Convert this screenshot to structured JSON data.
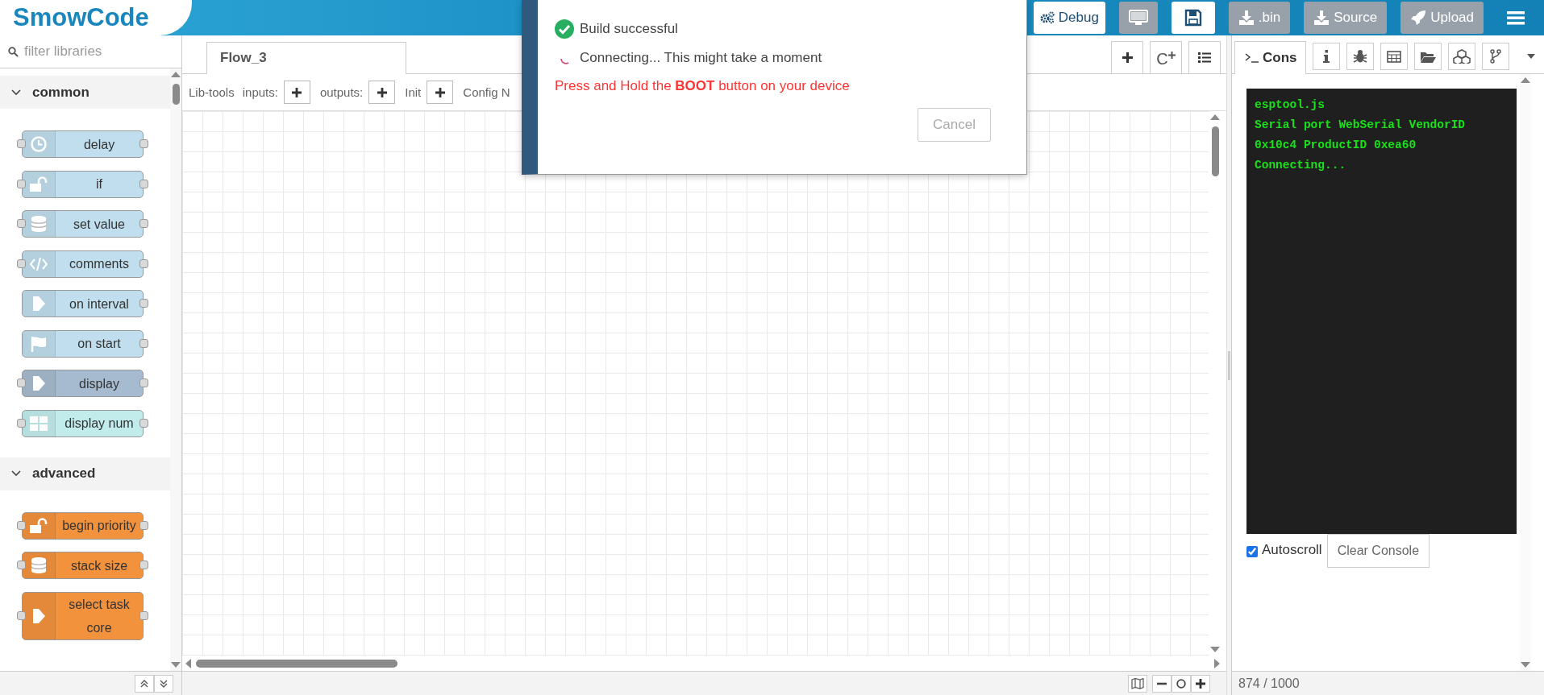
{
  "header": {
    "logo": "SmowCode",
    "buttons": [
      {
        "kind": "debug",
        "label": "Debug",
        "disabled": false
      },
      {
        "kind": "monitor",
        "disabled": true
      },
      {
        "kind": "save",
        "disabled": false
      },
      {
        "kind": "download",
        "label": ".bin",
        "disabled": true
      },
      {
        "kind": "download",
        "label": "Source",
        "disabled": true
      },
      {
        "kind": "upload",
        "label": "Upload",
        "disabled": true
      }
    ]
  },
  "palette": {
    "filter": {
      "placeholder": "filter libraries"
    },
    "categories": [
      {
        "name": "common",
        "expanded": true,
        "nodes": [
          {
            "label": "delay",
            "color": "#c0deed",
            "input": true,
            "output": true
          },
          {
            "label": "if",
            "color": "#c0deed",
            "input": true,
            "output": true
          },
          {
            "label": "set value",
            "color": "#c0deed",
            "input": true,
            "output": true
          },
          {
            "label": "comments",
            "color": "#c0deed",
            "input": true,
            "output": true
          },
          {
            "label": "on interval",
            "color": "#c0deed",
            "input": false,
            "output": true
          },
          {
            "label": "on start",
            "color": "#c0deed",
            "input": false,
            "output": true
          },
          {
            "label": "display",
            "color": "#a6bbcf",
            "input": true,
            "output": true
          },
          {
            "label": "display num",
            "color": "#c2ecec",
            "input": true,
            "output": true
          }
        ]
      },
      {
        "name": "advanced",
        "expanded": true,
        "nodes": [
          {
            "label": "begin priority",
            "color": "#f2923d",
            "input": true,
            "output": true
          },
          {
            "label": "stack size",
            "color": "#f2923d",
            "input": true,
            "output": true
          },
          {
            "label": "select task core",
            "color": "#f2923d",
            "input": true,
            "output": true
          }
        ]
      }
    ]
  },
  "workspace": {
    "tabs": [
      {
        "label": "Flow_3",
        "selected": true
      }
    ],
    "tab_actions": [
      {
        "kind": "add"
      },
      {
        "kind": "subflow",
        "label": "C"
      },
      {
        "kind": "list"
      }
    ],
    "toolbar": {
      "label": "Lib-tools",
      "fields": [
        {
          "label": "inputs:"
        },
        {
          "label": "outputs:"
        },
        {
          "label": "Init"
        }
      ],
      "cut_label": "Config N"
    }
  },
  "dialog": {
    "messages": [
      {
        "kind": "success",
        "text": "Build successful"
      },
      {
        "kind": "pending",
        "text": "Connecting... This might take a moment"
      }
    ],
    "warning": "Press and Hold the **BOOT** button on your device",
    "cancel": {
      "label": "Cancel",
      "disabled": true
    }
  },
  "sidebar": {
    "tabs": [
      {
        "kind": "console",
        "label": "Cons",
        "selected": true
      },
      {
        "kind": "info",
        "selected": false
      },
      {
        "kind": "debug",
        "selected": false
      },
      {
        "kind": "table",
        "selected": false
      },
      {
        "kind": "files",
        "selected": false
      },
      {
        "kind": "blocks",
        "selected": false
      },
      {
        "kind": "branch",
        "selected": false
      }
    ],
    "console": {
      "lines": [
        "esptool.js",
        "Serial port WebSerial VendorID",
        "0x10c4 ProductID 0xea60",
        "Connecting..."
      ]
    },
    "autoscroll": {
      "label": "Autoscroll",
      "checked": true
    },
    "clear_button": "Clear Console",
    "footer": "874 / 1000"
  }
}
